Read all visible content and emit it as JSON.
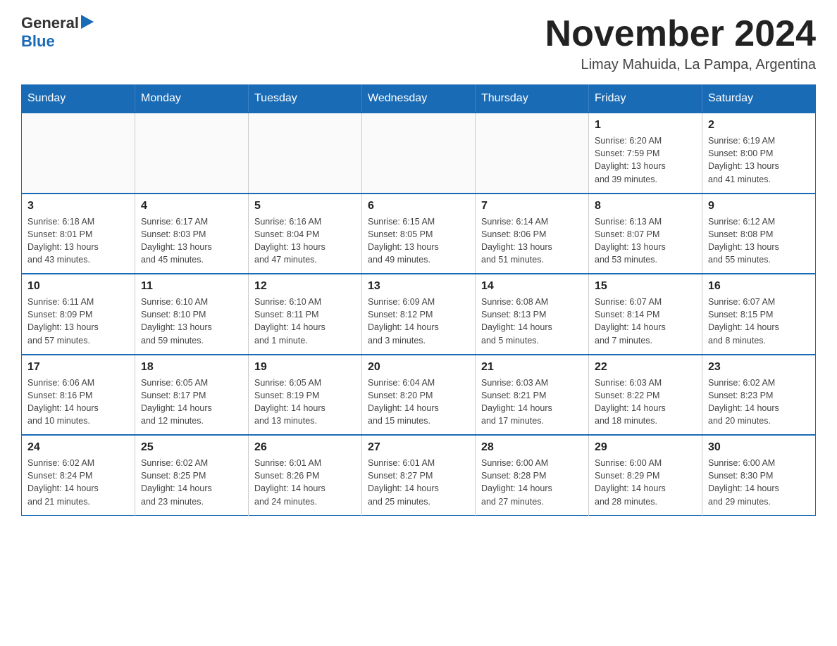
{
  "logo": {
    "text_general": "General",
    "text_blue": "Blue"
  },
  "title": "November 2024",
  "location": "Limay Mahuida, La Pampa, Argentina",
  "weekdays": [
    "Sunday",
    "Monday",
    "Tuesday",
    "Wednesday",
    "Thursday",
    "Friday",
    "Saturday"
  ],
  "weeks": [
    [
      {
        "day": "",
        "info": ""
      },
      {
        "day": "",
        "info": ""
      },
      {
        "day": "",
        "info": ""
      },
      {
        "day": "",
        "info": ""
      },
      {
        "day": "",
        "info": ""
      },
      {
        "day": "1",
        "info": "Sunrise: 6:20 AM\nSunset: 7:59 PM\nDaylight: 13 hours\nand 39 minutes."
      },
      {
        "day": "2",
        "info": "Sunrise: 6:19 AM\nSunset: 8:00 PM\nDaylight: 13 hours\nand 41 minutes."
      }
    ],
    [
      {
        "day": "3",
        "info": "Sunrise: 6:18 AM\nSunset: 8:01 PM\nDaylight: 13 hours\nand 43 minutes."
      },
      {
        "day": "4",
        "info": "Sunrise: 6:17 AM\nSunset: 8:03 PM\nDaylight: 13 hours\nand 45 minutes."
      },
      {
        "day": "5",
        "info": "Sunrise: 6:16 AM\nSunset: 8:04 PM\nDaylight: 13 hours\nand 47 minutes."
      },
      {
        "day": "6",
        "info": "Sunrise: 6:15 AM\nSunset: 8:05 PM\nDaylight: 13 hours\nand 49 minutes."
      },
      {
        "day": "7",
        "info": "Sunrise: 6:14 AM\nSunset: 8:06 PM\nDaylight: 13 hours\nand 51 minutes."
      },
      {
        "day": "8",
        "info": "Sunrise: 6:13 AM\nSunset: 8:07 PM\nDaylight: 13 hours\nand 53 minutes."
      },
      {
        "day": "9",
        "info": "Sunrise: 6:12 AM\nSunset: 8:08 PM\nDaylight: 13 hours\nand 55 minutes."
      }
    ],
    [
      {
        "day": "10",
        "info": "Sunrise: 6:11 AM\nSunset: 8:09 PM\nDaylight: 13 hours\nand 57 minutes."
      },
      {
        "day": "11",
        "info": "Sunrise: 6:10 AM\nSunset: 8:10 PM\nDaylight: 13 hours\nand 59 minutes."
      },
      {
        "day": "12",
        "info": "Sunrise: 6:10 AM\nSunset: 8:11 PM\nDaylight: 14 hours\nand 1 minute."
      },
      {
        "day": "13",
        "info": "Sunrise: 6:09 AM\nSunset: 8:12 PM\nDaylight: 14 hours\nand 3 minutes."
      },
      {
        "day": "14",
        "info": "Sunrise: 6:08 AM\nSunset: 8:13 PM\nDaylight: 14 hours\nand 5 minutes."
      },
      {
        "day": "15",
        "info": "Sunrise: 6:07 AM\nSunset: 8:14 PM\nDaylight: 14 hours\nand 7 minutes."
      },
      {
        "day": "16",
        "info": "Sunrise: 6:07 AM\nSunset: 8:15 PM\nDaylight: 14 hours\nand 8 minutes."
      }
    ],
    [
      {
        "day": "17",
        "info": "Sunrise: 6:06 AM\nSunset: 8:16 PM\nDaylight: 14 hours\nand 10 minutes."
      },
      {
        "day": "18",
        "info": "Sunrise: 6:05 AM\nSunset: 8:17 PM\nDaylight: 14 hours\nand 12 minutes."
      },
      {
        "day": "19",
        "info": "Sunrise: 6:05 AM\nSunset: 8:19 PM\nDaylight: 14 hours\nand 13 minutes."
      },
      {
        "day": "20",
        "info": "Sunrise: 6:04 AM\nSunset: 8:20 PM\nDaylight: 14 hours\nand 15 minutes."
      },
      {
        "day": "21",
        "info": "Sunrise: 6:03 AM\nSunset: 8:21 PM\nDaylight: 14 hours\nand 17 minutes."
      },
      {
        "day": "22",
        "info": "Sunrise: 6:03 AM\nSunset: 8:22 PM\nDaylight: 14 hours\nand 18 minutes."
      },
      {
        "day": "23",
        "info": "Sunrise: 6:02 AM\nSunset: 8:23 PM\nDaylight: 14 hours\nand 20 minutes."
      }
    ],
    [
      {
        "day": "24",
        "info": "Sunrise: 6:02 AM\nSunset: 8:24 PM\nDaylight: 14 hours\nand 21 minutes."
      },
      {
        "day": "25",
        "info": "Sunrise: 6:02 AM\nSunset: 8:25 PM\nDaylight: 14 hours\nand 23 minutes."
      },
      {
        "day": "26",
        "info": "Sunrise: 6:01 AM\nSunset: 8:26 PM\nDaylight: 14 hours\nand 24 minutes."
      },
      {
        "day": "27",
        "info": "Sunrise: 6:01 AM\nSunset: 8:27 PM\nDaylight: 14 hours\nand 25 minutes."
      },
      {
        "day": "28",
        "info": "Sunrise: 6:00 AM\nSunset: 8:28 PM\nDaylight: 14 hours\nand 27 minutes."
      },
      {
        "day": "29",
        "info": "Sunrise: 6:00 AM\nSunset: 8:29 PM\nDaylight: 14 hours\nand 28 minutes."
      },
      {
        "day": "30",
        "info": "Sunrise: 6:00 AM\nSunset: 8:30 PM\nDaylight: 14 hours\nand 29 minutes."
      }
    ]
  ]
}
